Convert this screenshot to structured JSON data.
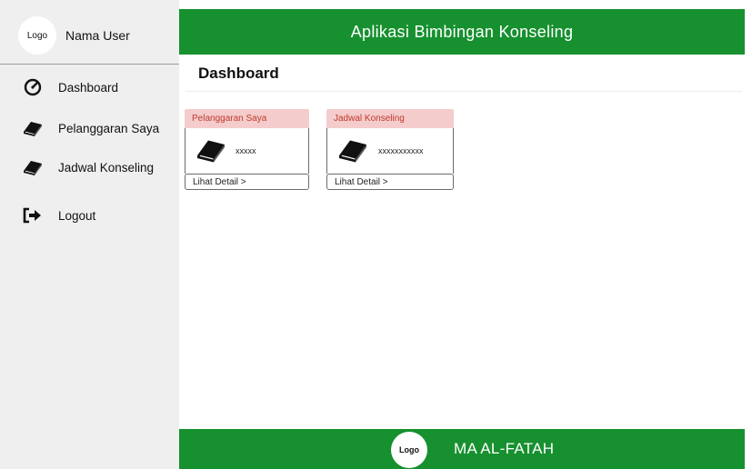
{
  "user": {
    "logo_text": "Logo",
    "name": "Nama User"
  },
  "sidebar": {
    "items": [
      {
        "label": "Dashboard",
        "icon": "dashboard-gauge-icon"
      },
      {
        "label": "Pelanggaran Saya",
        "icon": "book-icon"
      },
      {
        "label": "Jadwal Konseling",
        "icon": "book-icon"
      },
      {
        "label": "Logout",
        "icon": "logout-icon"
      }
    ]
  },
  "header": {
    "title": "Aplikasi Bimbingan Konseling"
  },
  "main": {
    "page_title": "Dashboard",
    "cards": [
      {
        "title": "Pelanggaran Saya",
        "value": "xxxxx",
        "detail_label": "Lihat Detail >",
        "icon": "book-icon"
      },
      {
        "title": "Jadwal Konseling",
        "value": "xxxxxxxxxxx",
        "detail_label": "Lihat Detail >",
        "icon": "book-icon"
      }
    ]
  },
  "footer": {
    "logo_text": "Logo",
    "school_name": "MA AL-FATAH"
  },
  "colors": {
    "primary_green": "#17902f",
    "sidebar_bg": "#efefef",
    "card_header_bg": "#f4cccc",
    "card_header_text": "#c0392b"
  }
}
